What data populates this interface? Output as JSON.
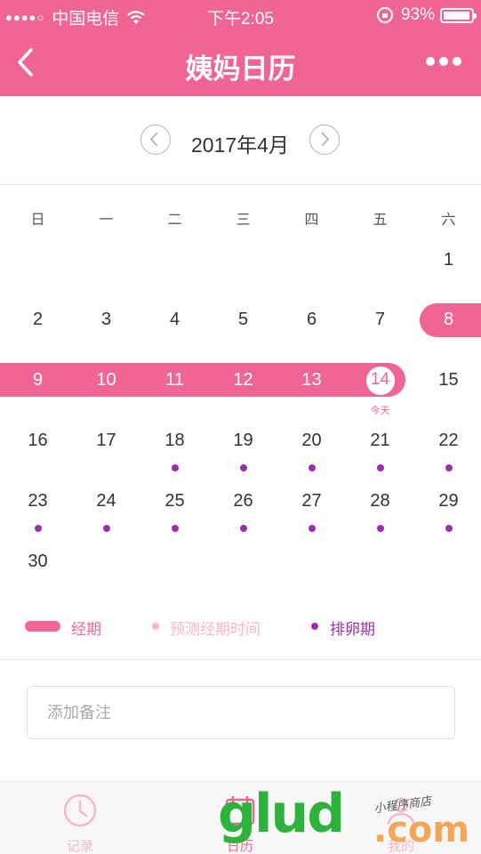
{
  "status_bar": {
    "carrier": "中国电信",
    "time": "下午2:05",
    "battery": "93%"
  },
  "nav": {
    "title": "姨妈日历"
  },
  "calendar": {
    "month_label": "2017年4月",
    "weekdays": [
      "日",
      "一",
      "二",
      "三",
      "四",
      "五",
      "六"
    ],
    "days": [
      "1",
      "2",
      "3",
      "4",
      "5",
      "6",
      "7",
      "8",
      "9",
      "10",
      "11",
      "12",
      "13",
      "14",
      "15",
      "16",
      "17",
      "18",
      "19",
      "20",
      "21",
      "22",
      "23",
      "24",
      "25",
      "26",
      "27",
      "28",
      "29",
      "30"
    ],
    "today_label": "今天",
    "today": 14,
    "period_days": [
      8,
      9,
      10,
      11,
      12,
      13,
      14
    ],
    "ovulation_days": [
      18,
      19,
      20,
      21,
      22,
      23,
      24,
      25,
      26,
      27,
      28,
      29
    ]
  },
  "legend": {
    "period": "经期",
    "predicted": "预测经期时间",
    "ovulation": "排卵期"
  },
  "note": {
    "placeholder": "添加备注"
  },
  "tabbar": {
    "record": "记录",
    "calendar": "日历",
    "profile": "我的"
  },
  "watermark": {
    "logo": "glud",
    "suffix": ".com",
    "tagline": "小程序商店"
  },
  "colors": {
    "accent": "#f06593",
    "ovulation": "#9b2dae",
    "predicted": "#f7b6c9"
  }
}
